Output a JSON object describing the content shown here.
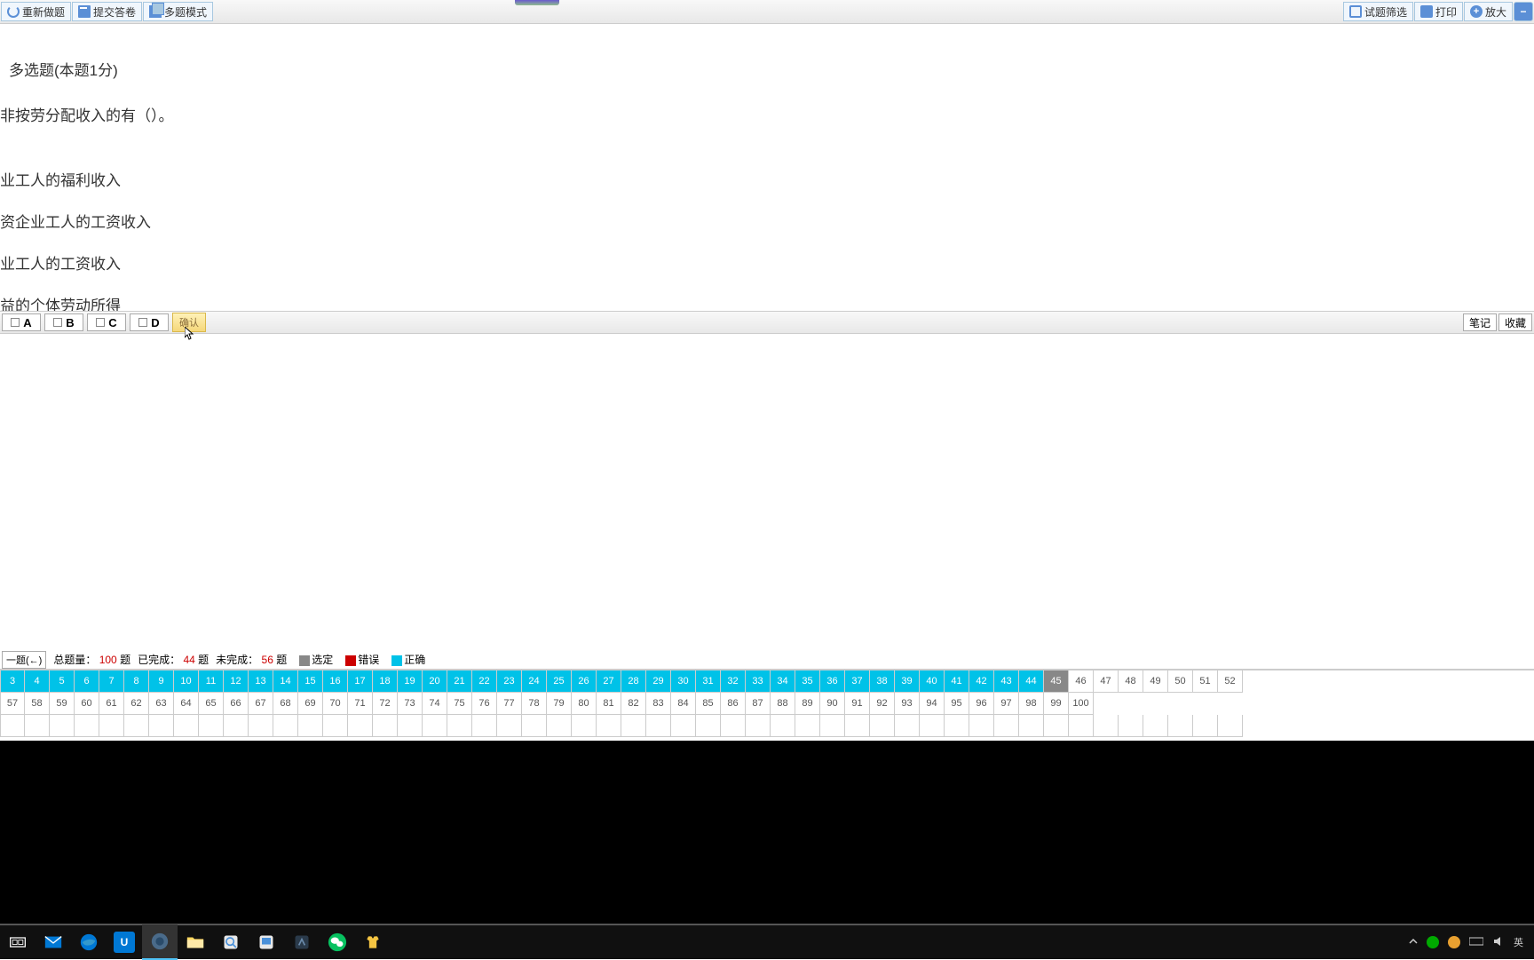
{
  "toolbar": {
    "left": [
      {
        "label": "重新做题",
        "icon": "refresh-icon"
      },
      {
        "label": "提交答卷",
        "icon": "submit-icon"
      },
      {
        "label": "多题模式",
        "icon": "multi-icon"
      }
    ],
    "right": [
      {
        "label": "试题筛选",
        "icon": "filter-icon"
      },
      {
        "label": "打印",
        "icon": "print-icon"
      },
      {
        "label": "放大",
        "icon": "zoom-icon"
      }
    ]
  },
  "question": {
    "type_label": "多选题(本题1分)",
    "text": "非按劳分配收入的有（）。",
    "options": [
      "业工人的福利收入",
      "资企业工人的工资收入",
      "业工人的工资收入",
      "益的个体劳动所得"
    ]
  },
  "answer_bar": {
    "choices": [
      "A",
      "B",
      "C",
      "D"
    ],
    "confirm": "确认",
    "note": "笔记",
    "favorite": "收藏"
  },
  "status": {
    "prev_label": "一题(←)",
    "total_label": "总题量：",
    "total_value": "100",
    "unit": "题",
    "done_label": "已完成：",
    "done_value": "44",
    "undone_label": "未完成：",
    "undone_value": "56",
    "legend_selected": "选定",
    "legend_wrong": "错误",
    "legend_right": "正确"
  },
  "nav": {
    "current": 45,
    "done_through": 44,
    "total": 100,
    "row1_start": 3,
    "row1_end": 52,
    "row2_start": 57,
    "row2_end": 100
  },
  "tray": {
    "ime": "英"
  }
}
